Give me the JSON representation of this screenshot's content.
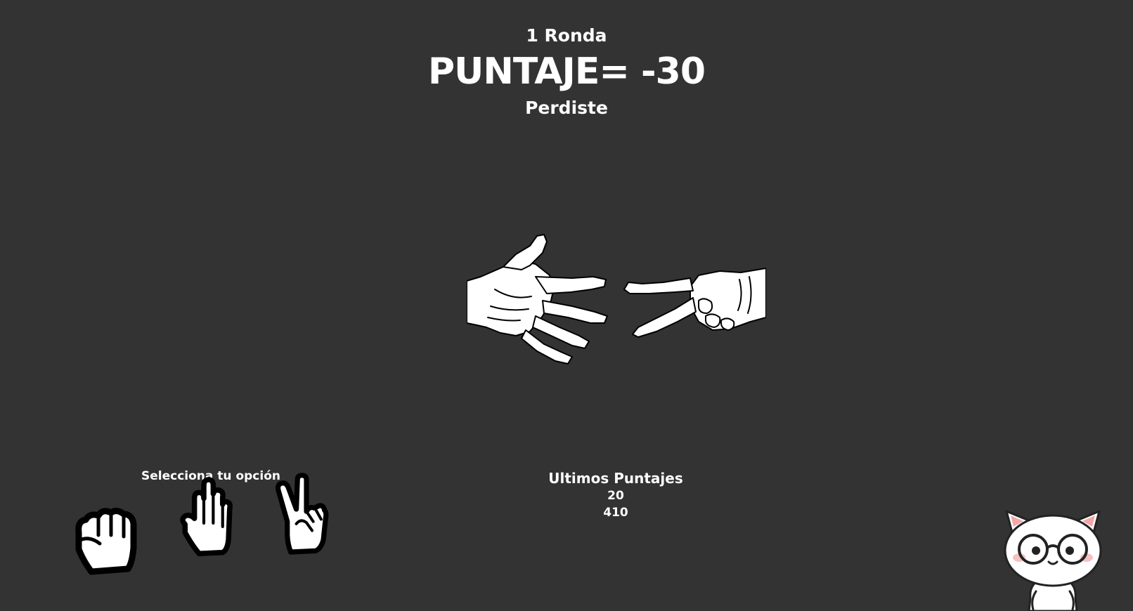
{
  "game": {
    "round_label": "1 Ronda",
    "score_label": "PUNTAJE= -30",
    "result_label": "Perdiste"
  },
  "duel": {
    "player_hand": "paper-hand",
    "opponent_hand": "scissors-hand"
  },
  "choices": {
    "title": "Selecciona tu opción",
    "options": [
      {
        "name": "rock",
        "icon": "fist-icon"
      },
      {
        "name": "paper",
        "icon": "open-hand-icon"
      },
      {
        "name": "scissors",
        "icon": "peace-hand-icon"
      }
    ]
  },
  "scores": {
    "title": "Ultimos Puntajes",
    "items": [
      "20",
      "410"
    ]
  },
  "colors": {
    "background": "#333333",
    "text": "#ffffff",
    "icon_fill": "#ffffff",
    "icon_outline": "#000000"
  }
}
